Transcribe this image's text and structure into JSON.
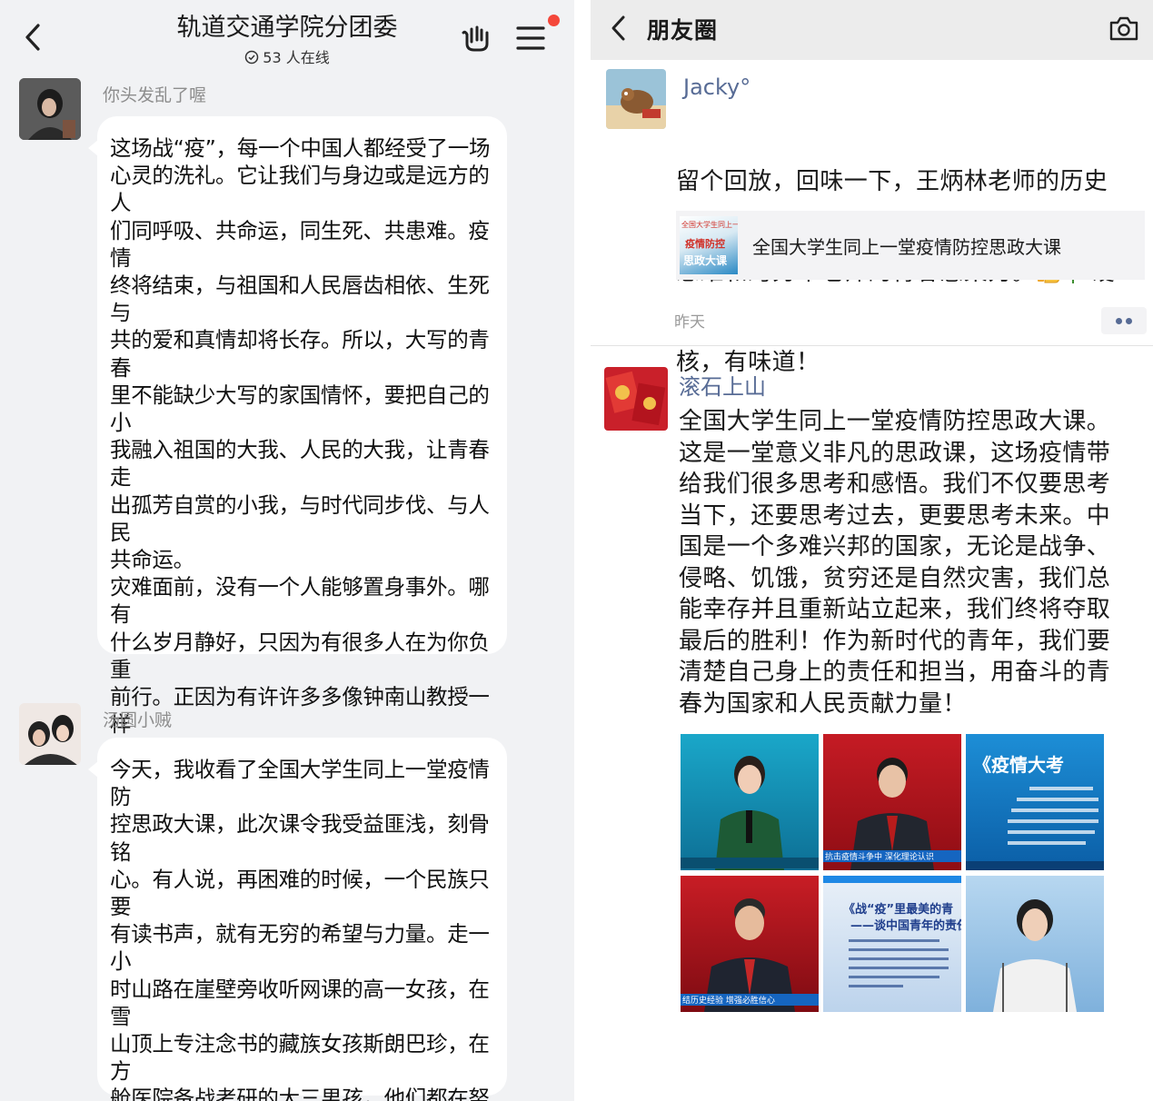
{
  "chat": {
    "title": "轨道交通学院分团委",
    "online": "53 人在线",
    "messages": [
      {
        "sender": "你头发乱了喔",
        "text": "这场战“疫”，每一个中国人都经受了一场\n心灵的洗礼。它让我们与身边或是远方的人\n们同呼吸、共命运，同生死、共患难。疫情\n终将结束，与祖国和人民唇齿相依、生死与\n共的爱和真情却将长存。所以，大写的青春\n里不能缺少大写的家国情怀，要把自己的小\n我融入祖国的大我、人民的大我，让青春走\n出孤芳自赏的小我，与时代同步伐、与人民\n共命运。\n灾难面前，没有一个人能够置身事外。哪有\n什么岁月静好，只因为有很多人在为你负重\n前行。正因为有许许多多像钟南山教授一样\n的最美逆行者，我们才能拥有自己生活的小\n确幸。作为一名新时代的大学生，虽然不能\n像他们一样义无反顾地冲到疫情防控一线，\n但我深知以后上战场的将是我们，我一定会\n以他们为榜样，坚定理想信念，刻苦学习本\n领，到祖国最需要我的地方去。"
      },
      {
        "sender": "汤圆小贼",
        "text": "今天，我收看了全国大学生同上一堂疫情防\n控思政大课，此次课令我受益匪浅，刻骨铭\n心。有人说，再困难的时候，一个民族只要\n有读书声，就有无穷的希望与力量。走一小\n时山路在崖壁旁收听网课的高一女孩，在雪\n山顶上专注念书的藏族女孩斯朗巴珍，在方\n舱医院备战考研的大三男孩，他们都在努力\n用读书积蓄力量，用拼搏昭示希望。所以，\n大写的青春里不能缺少过硬的本领，要用硬\n核的专业本领来回应时代挑战、担当时代使\n命。"
      }
    ]
  },
  "moments": {
    "title": "朋友圈",
    "post1": {
      "name": "Jacky°",
      "text_line1": "留个回放，回味一下，王炳林老师的历史",
      "text_line2a": "思维和冯秀军老师的青春感染力。",
      "text_line2b": "硬",
      "text_line3": "核，有味道！",
      "link_title": "全国大学生同上一堂疫情防控思政大课",
      "thumb_text": [
        "全国大学生同上一",
        "疫情防控",
        "思政大课"
      ],
      "time": "昨天"
    },
    "post2": {
      "name": "滚石上山",
      "text": "全国大学生同上一堂疫情防控思政大课。\n这是一堂意义非凡的思政课，这场疫情带\n给我们很多思考和感悟。我们不仅要思考\n当下，还要思考过去，更要思考未来。中\n国是一个多难兴邦的国家，无论是战争、\n侵略、饥饿，贫穷还是自然灾害，我们总\n能幸存并且重新站立起来，我们终将夺取\n最后的胜利！作为新时代的青年，我们要\n清楚自己身上的责任和担当，用奋斗的青\n春为国家和人民贡献力量！",
      "images": [
        {
          "caption": "抗击疫情斗争中 深化理论认识"
        },
        {
          "caption": "《疫情大考"
        },
        {
          "caption": "结历史经验 增强必胜信心"
        },
        {
          "caption": "《战“疫”里最美的青"
        },
        {
          "caption": "——谈中国青年的责任"
        }
      ]
    }
  },
  "colors": {
    "accent_link": "#576b95",
    "notify_dot": "#f4473a",
    "chat_bg": "#f1f2f4"
  }
}
